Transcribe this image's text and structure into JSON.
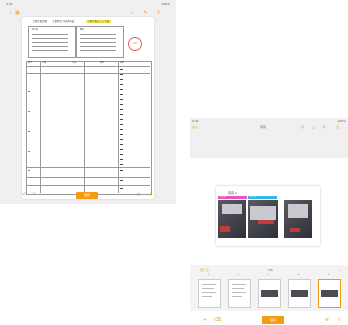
{
  "left": {
    "status": {
      "time": "9:41",
      "battery": "100%"
    },
    "toolbar": {
      "icons": [
        "back-icon",
        "grid-icon",
        "search-icon",
        "edit-icon",
        "share-icon"
      ]
    },
    "doc": {
      "header_left": "工事写真台帳",
      "header_right": "工事件名 令和3年度",
      "highlight": "工事写真チェック表",
      "row_label_1": "施工者",
      "row_label_2": "確認",
      "stamp_text": "承認",
      "table_headers": [
        "番号",
        "工種",
        "写真",
        "確認",
        "摘要"
      ]
    },
    "bottom": {
      "button_label": "保存",
      "icons": [
        "undo-icon",
        "redo-icon",
        "list-icon",
        "add-icon"
      ]
    }
  },
  "right": {
    "status": {
      "time": "9:41",
      "battery": "100%"
    },
    "toolbar": {
      "back_label": "戻る",
      "title": "写真",
      "icons": [
        "pen-icon",
        "search-icon",
        "edit-icon",
        "share-icon"
      ]
    },
    "card": {
      "title": "写真 1",
      "tags": [
        {
          "label": "施工前",
          "color": "#ec54c6"
        },
        {
          "label": "施工後",
          "color": "#33b5e5"
        }
      ]
    },
    "thumbbar": {
      "left_label": "閉じる",
      "mid_label": "1/5",
      "right_label": "+",
      "pages": [
        "1",
        "2",
        "3",
        "4",
        "5"
      ]
    },
    "bottom": {
      "button_label": "保存",
      "icons": [
        "add-icon",
        "trash-icon",
        "list-icon",
        "share-icon"
      ]
    }
  },
  "colors": {
    "accent": "#f39c12",
    "highlight": "#f6ef57"
  }
}
